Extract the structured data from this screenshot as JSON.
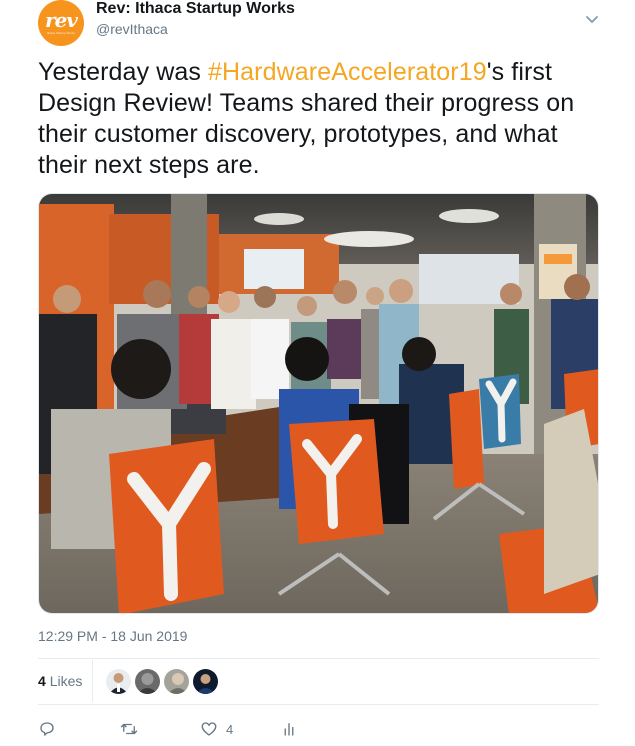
{
  "account": {
    "display_name": "Rev: Ithaca Startup Works",
    "handle": "@revIthaca",
    "avatar_text": "rev",
    "avatar_subtext": "Ithaca Startup Works",
    "brand_color": "#f7941d"
  },
  "tweet": {
    "text_before": "Yesterday was ",
    "hashtag": "#HardwareAccelerator19",
    "text_after": "'s first Design Review! Teams shared their progress on their customer discovery, prototypes, and what their next steps are.",
    "hashtag_color": "#f5a623",
    "timestamp": "12:29 PM - 18 Jun 2019"
  },
  "stats": {
    "likes_count": "4",
    "likes_label": "Likes"
  },
  "actions": {
    "reply_count": "",
    "retweet_count": "",
    "like_count": "4",
    "icons": [
      "reply-icon",
      "retweet-icon",
      "like-icon",
      "analytics-icon"
    ]
  },
  "photo": {
    "description_icon": "photo"
  }
}
